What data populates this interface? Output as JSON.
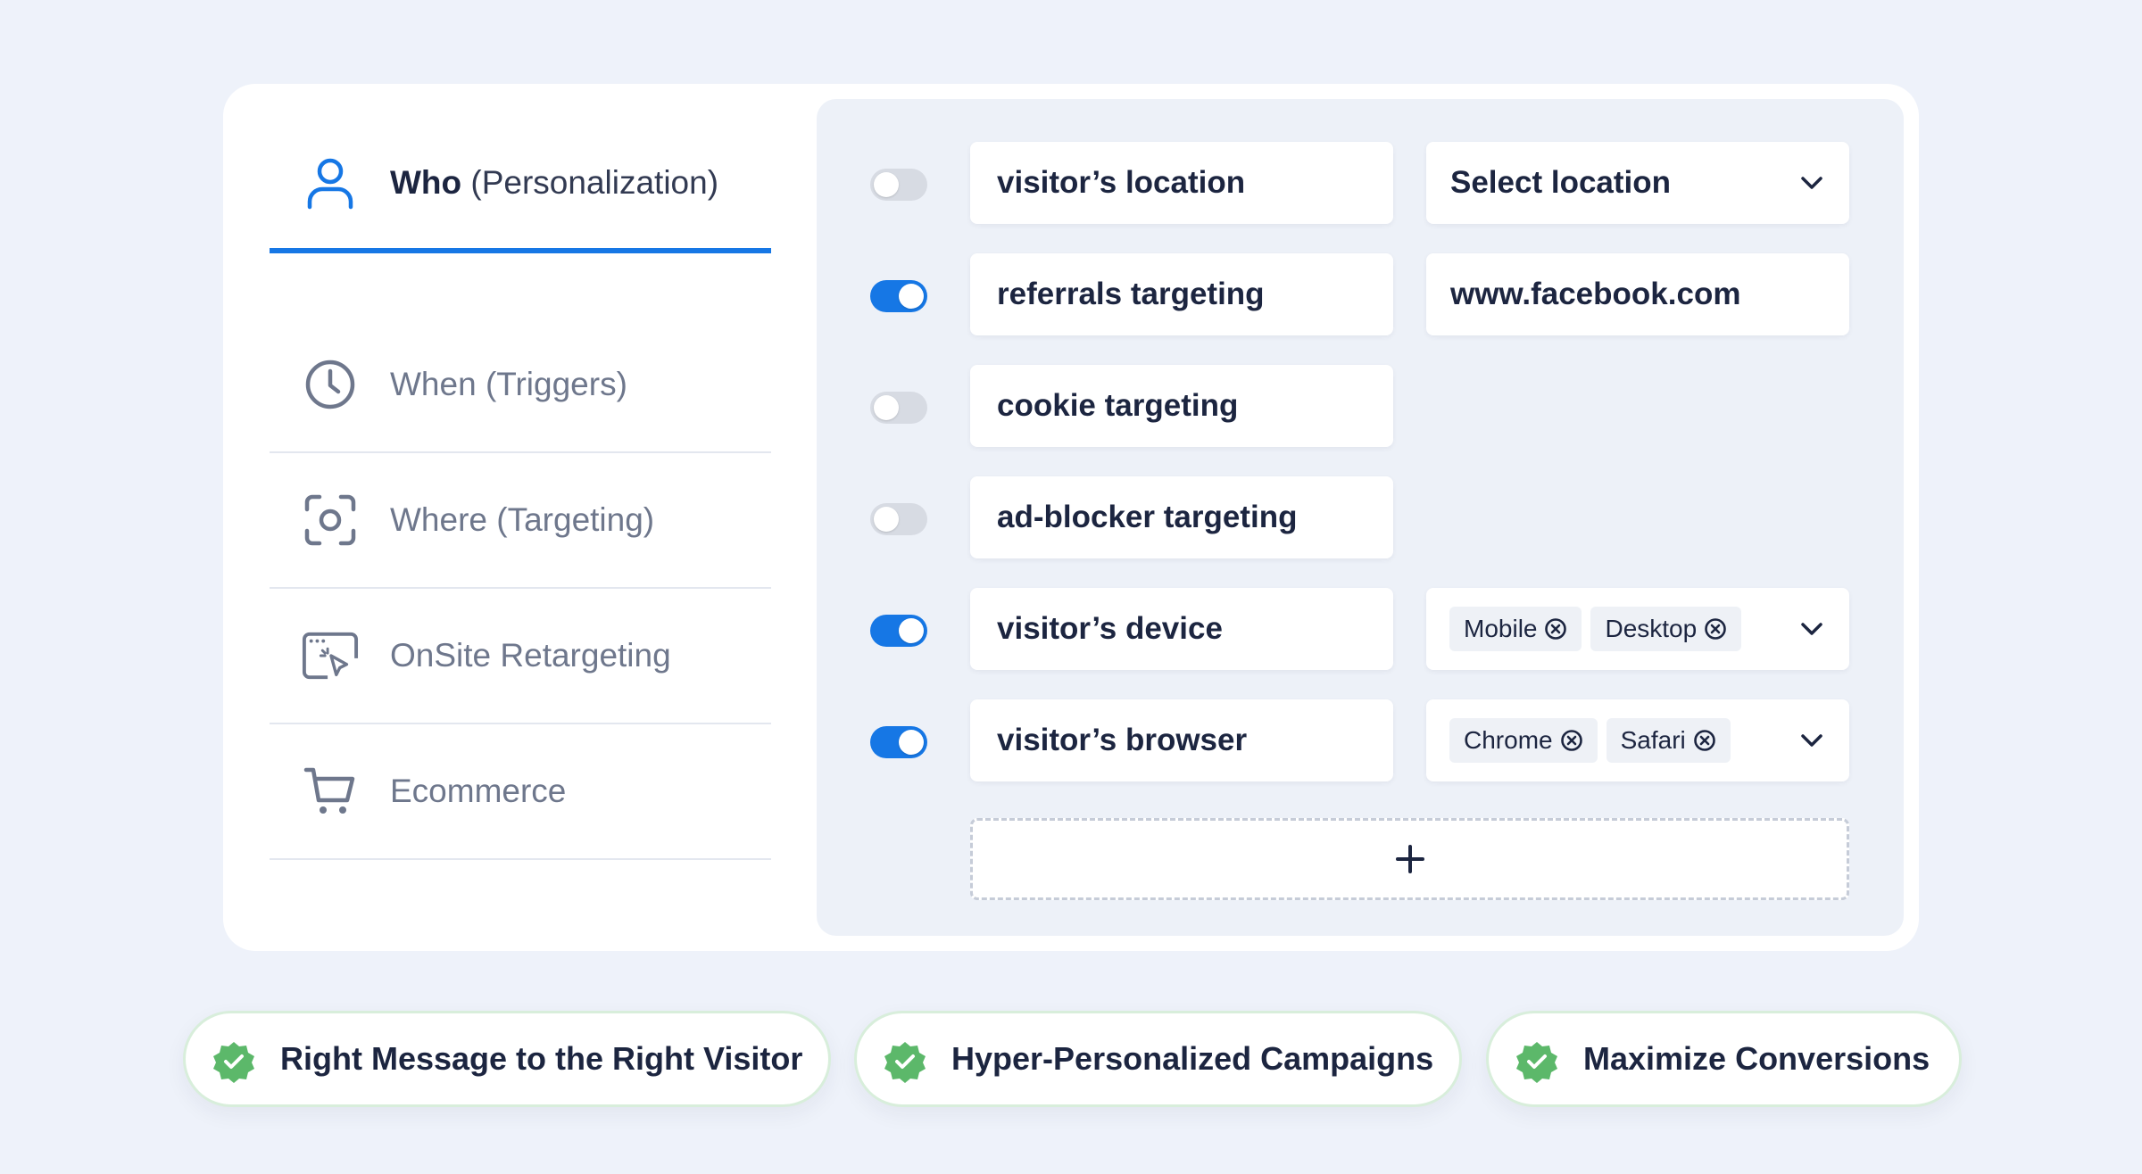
{
  "sidebar": {
    "items": [
      {
        "bold": "Who",
        "paren": "(Personalization)"
      },
      {
        "bold": "When",
        "paren": "(Triggers)"
      },
      {
        "bold": "Where",
        "paren": "(Targeting)"
      },
      {
        "bold": "OnSite Retargeting",
        "paren": ""
      },
      {
        "bold": "Ecommerce",
        "paren": ""
      }
    ],
    "active_index": 0,
    "icons": [
      "user-icon",
      "clock-icon",
      "target-icon",
      "cursor-click-icon",
      "cart-icon"
    ]
  },
  "rules": [
    {
      "label": "visitor’s location",
      "enabled": false,
      "value": "Select location",
      "dropdown": true
    },
    {
      "label": "referrals targeting",
      "enabled": true,
      "value": "www.facebook.com",
      "dropdown": false
    },
    {
      "label": "cookie targeting",
      "enabled": false
    },
    {
      "label": "ad-blocker targeting",
      "enabled": false
    },
    {
      "label": "visitor’s device",
      "enabled": true,
      "chips": [
        "Mobile",
        "Desktop"
      ],
      "dropdown": true
    },
    {
      "label": "visitor’s browser",
      "enabled": true,
      "chips": [
        "Chrome",
        "Safari"
      ],
      "dropdown": true
    }
  ],
  "add_rule_label": "+",
  "benefits": [
    "Right Message to the Right Visitor",
    "Hyper-Personalized Campaigns",
    "Maximize Conversions"
  ],
  "colors": {
    "accent": "#1677e5",
    "check_green": "#5cb86a",
    "background": "#eef2fa"
  }
}
